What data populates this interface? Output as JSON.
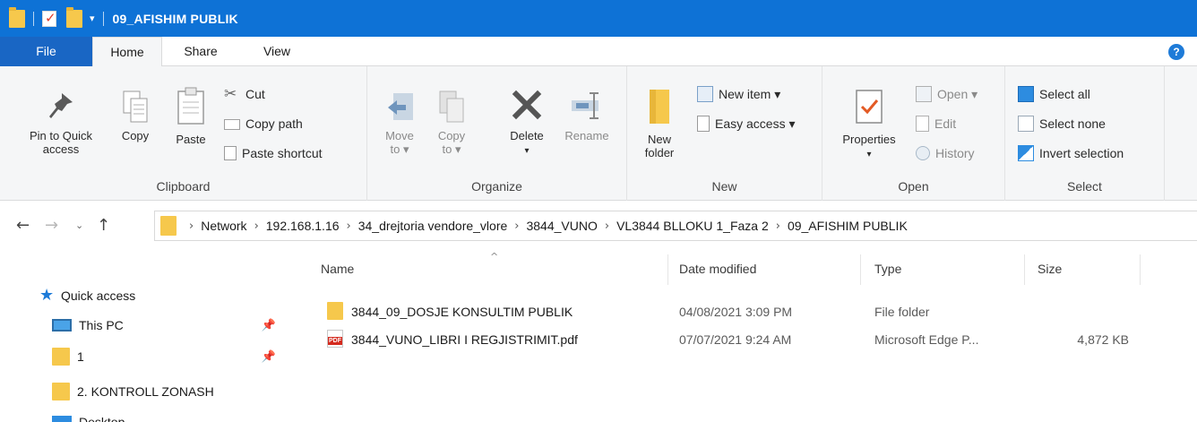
{
  "window": {
    "title": "09_AFISHIM PUBLIK"
  },
  "tabs": {
    "file": "File",
    "home": "Home",
    "share": "Share",
    "view": "View",
    "help": "?"
  },
  "ribbon": {
    "clipboard": {
      "label": "Clipboard",
      "pin_l1": "Pin to Quick",
      "pin_l2": "access",
      "copy": "Copy",
      "paste": "Paste",
      "cut": "Cut",
      "copy_path": "Copy path",
      "paste_shortcut": "Paste shortcut"
    },
    "organize": {
      "label": "Organize",
      "move_l1": "Move",
      "move_l2": "to ▾",
      "copyto_l1": "Copy",
      "copyto_l2": "to ▾",
      "delete": "Delete",
      "delete_arrow": "▾",
      "rename": "Rename"
    },
    "new": {
      "label": "New",
      "new_folder_l1": "New",
      "new_folder_l2": "folder",
      "new_item": "New item ▾",
      "easy_access": "Easy access ▾"
    },
    "open": {
      "label": "Open",
      "properties": "Properties",
      "properties_arrow": "▾",
      "open": "Open ▾",
      "edit": "Edit",
      "history": "History"
    },
    "select": {
      "label": "Select",
      "select_all": "Select all",
      "select_none": "Select none",
      "invert_selection": "Invert selection"
    }
  },
  "address": {
    "crumbs": [
      "Network",
      "192.168.1.16",
      "34_drejtoria vendore_vlore",
      "3844_VUNO",
      "VL3844 BLLOKU 1_Faza 2",
      "09_AFISHIM PUBLIK"
    ]
  },
  "navpane": {
    "items": [
      "Quick access",
      "This PC",
      "1",
      "2. KONTROLL ZONASH",
      "Desktop"
    ]
  },
  "columns": {
    "name": "Name",
    "date": "Date modified",
    "type": "Type",
    "size": "Size"
  },
  "files": [
    {
      "name": "3844_09_DOSJE KONSULTIM PUBLIK",
      "date": "04/08/2021 3:09 PM",
      "type": "File folder",
      "size": "",
      "icon": "folder-icon"
    },
    {
      "name": "3844_VUNO_LIBRI I REGJISTRIMIT.pdf",
      "date": "07/07/2021 9:24 AM",
      "type": "Microsoft Edge P...",
      "size": "4,872 KB",
      "icon": "pdf-icon",
      "icon_text": "PDF"
    }
  ],
  "colors": {
    "titlebar": "#0e72d6",
    "file_tab": "#1966c4",
    "folder": "#f6c84c",
    "ribbon_bg": "#f5f6f7"
  }
}
